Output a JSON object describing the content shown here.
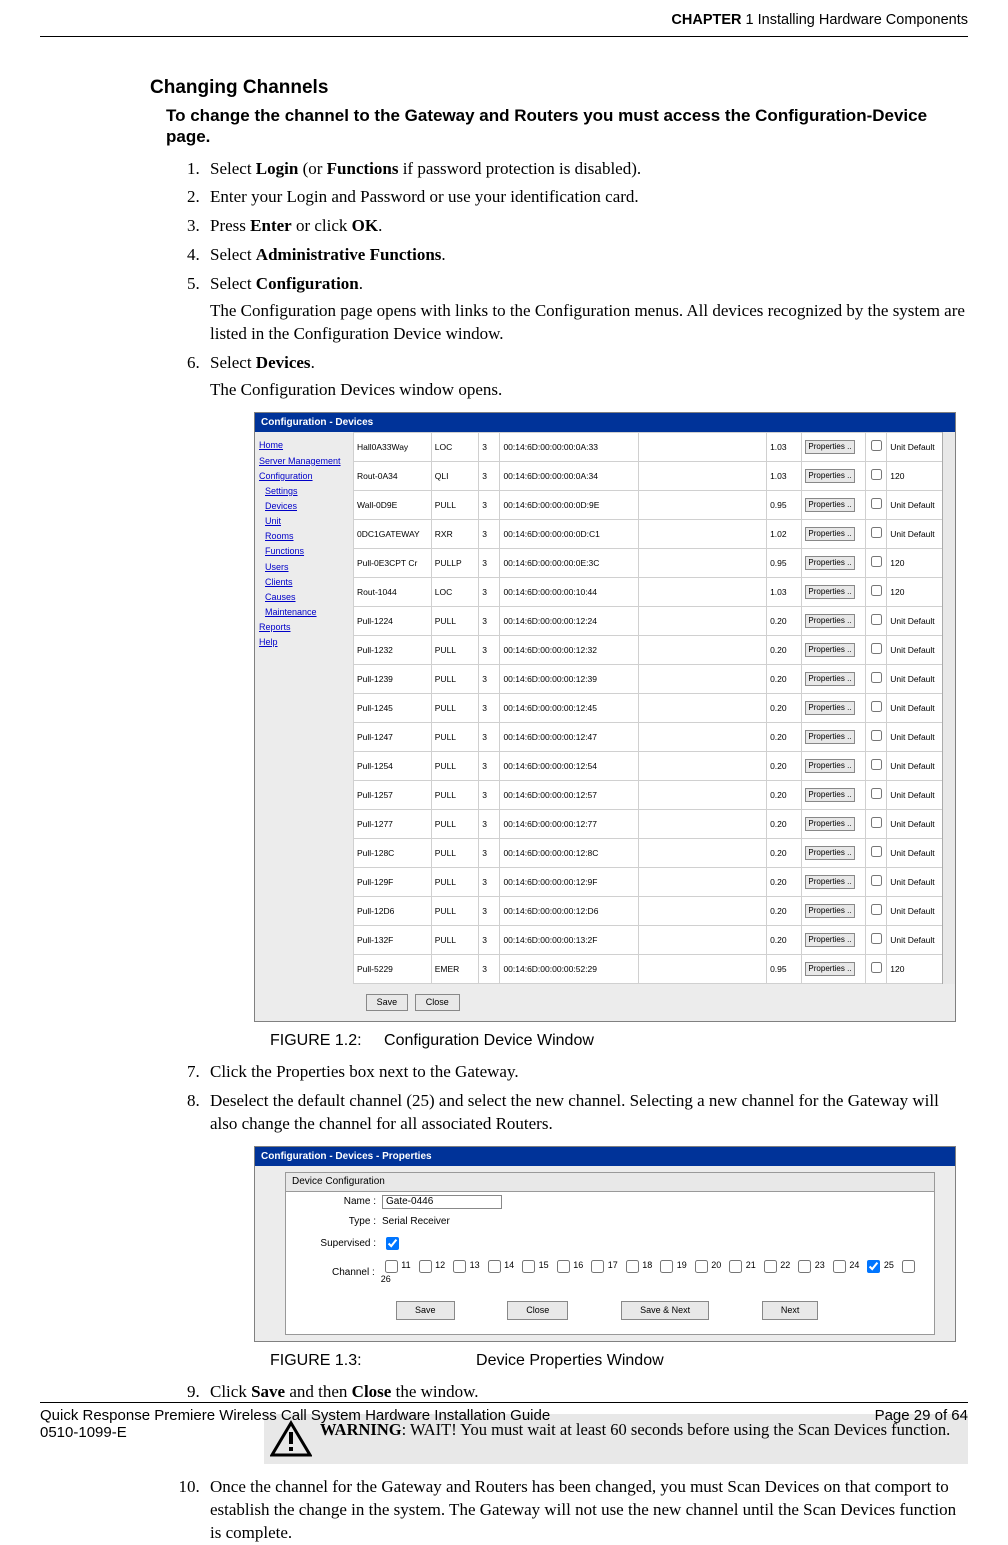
{
  "header": {
    "chapter_prefix": "CHAPTER",
    "chapter_num": "1",
    "chapter_title": "Installing Hardware Components"
  },
  "section_title": "Changing Channels",
  "intro": "To change the channel to the Gateway and Routers you must access the Configuration-Device page.",
  "steps": {
    "s1": {
      "pre": "Select ",
      "b1": "Login",
      "mid": " (or ",
      "b2": "Functions",
      "post": " if password protection is disabled)."
    },
    "s2": "Enter your Login and Password or use your identification card.",
    "s3": {
      "pre": "Press ",
      "b1": "Enter",
      "mid": " or click ",
      "b2": "OK",
      "post": "."
    },
    "s4": {
      "pre": "Select ",
      "b1": "Administrative Functions",
      "post": "."
    },
    "s5": {
      "pre": "Select ",
      "b1": "Configuration",
      "post": "."
    },
    "s5_sub": "The Configuration page opens with links to the Configuration menus. All devices recognized by the system are listed in the Configuration Device window.",
    "s6": {
      "pre": "Select ",
      "b1": "Devices",
      "post": "."
    },
    "s6_sub": "The Configuration Devices window opens.",
    "s7": "Click the Properties box next to the Gateway.",
    "s8": "Deselect the default channel (25) and select the new channel. Selecting a new channel for the Gateway will also change the channel for all associated Routers.",
    "s9": {
      "pre": "Click ",
      "b1": "Save",
      "mid": " and then ",
      "b2": "Close",
      "post": " the window."
    },
    "s10": "Once the channel for the Gateway and Routers has been changed, you must Scan Devices on that comport to establish the change in the system. The Gateway will not use the new channel until the Scan Devices function is complete."
  },
  "fig12": {
    "caption_num": "FIGURE 1.2:",
    "caption_text": "Configuration Device Window",
    "titlebar": "Configuration - Devices",
    "nav": [
      "Home",
      "Server Management",
      "Configuration",
      "Settings",
      "Devices",
      "Unit",
      "Rooms",
      "Functions",
      "Users",
      "Clients",
      "Causes",
      "Maintenance",
      "Reports",
      "Help"
    ],
    "nav_indent": [
      false,
      false,
      false,
      true,
      true,
      true,
      true,
      true,
      true,
      true,
      true,
      true,
      false,
      false
    ],
    "rows": [
      [
        "Hall0A33Way",
        "LOC",
        "3",
        "00:14:6D:00:00:00:0A:33",
        "",
        "1.03",
        "Properties ..",
        "",
        "Unit Default"
      ],
      [
        "Rout-0A34",
        "QLI",
        "3",
        "00:14:6D:00:00:00:0A:34",
        "",
        "1.03",
        "Properties ..",
        "",
        "120"
      ],
      [
        "Wall-0D9E",
        "PULL",
        "3",
        "00:14:6D:00:00:00:0D:9E",
        "",
        "0.95",
        "Properties ..",
        "",
        "Unit Default"
      ],
      [
        "0DC1GATEWAY",
        "RXR",
        "3",
        "00:14:6D:00:00:00:0D:C1",
        "",
        "1.02",
        "Properties ..",
        "",
        "Unit Default"
      ],
      [
        "Pull-0E3CPT Cr",
        "PULLP",
        "3",
        "00:14:6D:00:00:00:0E:3C",
        "",
        "0.95",
        "Properties ..",
        "",
        "120"
      ],
      [
        "Rout-1044",
        "LOC",
        "3",
        "00:14:6D:00:00:00:10:44",
        "",
        "1.03",
        "Properties ..",
        "",
        "120"
      ],
      [
        "Pull-1224",
        "PULL",
        "3",
        "00:14:6D:00:00:00:12:24",
        "",
        "0.20",
        "Properties ..",
        "",
        "Unit Default"
      ],
      [
        "Pull-1232",
        "PULL",
        "3",
        "00:14:6D:00:00:00:12:32",
        "",
        "0.20",
        "Properties ..",
        "",
        "Unit Default"
      ],
      [
        "Pull-1239",
        "PULL",
        "3",
        "00:14:6D:00:00:00:12:39",
        "",
        "0.20",
        "Properties ..",
        "",
        "Unit Default"
      ],
      [
        "Pull-1245",
        "PULL",
        "3",
        "00:14:6D:00:00:00:12:45",
        "",
        "0.20",
        "Properties ..",
        "",
        "Unit Default"
      ],
      [
        "Pull-1247",
        "PULL",
        "3",
        "00:14:6D:00:00:00:12:47",
        "",
        "0.20",
        "Properties ..",
        "",
        "Unit Default"
      ],
      [
        "Pull-1254",
        "PULL",
        "3",
        "00:14:6D:00:00:00:12:54",
        "",
        "0.20",
        "Properties ..",
        "",
        "Unit Default"
      ],
      [
        "Pull-1257",
        "PULL",
        "3",
        "00:14:6D:00:00:00:12:57",
        "",
        "0.20",
        "Properties ..",
        "",
        "Unit Default"
      ],
      [
        "Pull-1277",
        "PULL",
        "3",
        "00:14:6D:00:00:00:12:77",
        "",
        "0.20",
        "Properties ..",
        "",
        "Unit Default"
      ],
      [
        "Pull-128C",
        "PULL",
        "3",
        "00:14:6D:00:00:00:12:8C",
        "",
        "0.20",
        "Properties ..",
        "",
        "Unit Default"
      ],
      [
        "Pull-129F",
        "PULL",
        "3",
        "00:14:6D:00:00:00:12:9F",
        "",
        "0.20",
        "Properties ..",
        "",
        "Unit Default"
      ],
      [
        "Pull-12D6",
        "PULL",
        "3",
        "00:14:6D:00:00:00:12:D6",
        "",
        "0.20",
        "Properties ..",
        "",
        "Unit Default"
      ],
      [
        "Pull-132F",
        "PULL",
        "3",
        "00:14:6D:00:00:00:13:2F",
        "",
        "0.20",
        "Properties ..",
        "",
        "Unit Default"
      ],
      [
        "Pull-5229",
        "EMER",
        "3",
        "00:14:6D:00:00:00:52:29",
        "",
        "0.95",
        "Properties ..",
        "",
        "120"
      ]
    ],
    "save_btn": "Save",
    "close_btn": "Close"
  },
  "fig13": {
    "caption_num": "FIGURE 1.3:",
    "caption_text": "Device Properties Window",
    "titlebar": "Configuration - Devices - Properties",
    "group_label": "Device Configuration",
    "name_label": "Name :",
    "name_value": "Gate-0446",
    "type_label": "Type :",
    "type_value": "Serial Receiver",
    "supervised_label": "Supervised :",
    "channel_label": "Channel :",
    "channels": [
      "11",
      "12",
      "13",
      "14",
      "15",
      "16",
      "17",
      "18",
      "19",
      "20",
      "21",
      "22",
      "23",
      "24",
      "25",
      "26"
    ],
    "channel_selected": "25",
    "save_btn": "Save",
    "close_btn": "Close",
    "savenext_btn": "Save & Next",
    "next_btn": "Next"
  },
  "warning": {
    "heading": "WARNING",
    "text": ": WAIT! You must wait at least 60 seconds before using the Scan Devices function."
  },
  "footer": {
    "doc_title": "Quick Response Premiere Wireless Call System Hardware Installation Guide",
    "doc_num": "0510-1099-E",
    "page": "Page 29 of 64"
  }
}
